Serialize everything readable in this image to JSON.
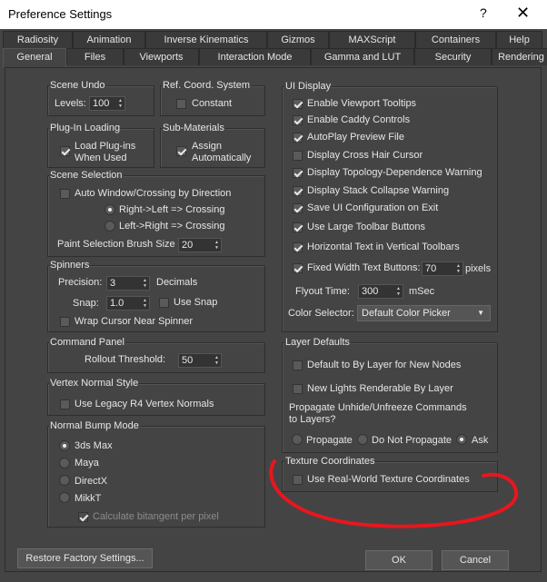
{
  "window": {
    "title": "Preference Settings",
    "help": "?",
    "close": "✕"
  },
  "tabs": {
    "row1": [
      "Radiosity",
      "Animation",
      "Inverse Kinematics",
      "Gizmos",
      "MAXScript",
      "Containers",
      "Help"
    ],
    "row2": [
      "General",
      "Files",
      "Viewports",
      "Interaction Mode",
      "Gamma and LUT",
      "Security",
      "Rendering"
    ],
    "active": "General"
  },
  "scene_undo": {
    "title": "Scene Undo",
    "levels_label": "Levels:",
    "levels_value": "100"
  },
  "ref_coord": {
    "title": "Ref. Coord. System",
    "constant": "Constant"
  },
  "plugin_loading": {
    "title": "Plug-In Loading",
    "load_line1": "Load Plug-ins",
    "load_line2": "When Used"
  },
  "sub_materials": {
    "title": "Sub-Materials",
    "assign_line1": "Assign",
    "assign_line2": "Automatically"
  },
  "scene_selection": {
    "title": "Scene Selection",
    "auto_window": "Auto Window/Crossing by Direction",
    "right_left": "Right->Left => Crossing",
    "left_right": "Left->Right => Crossing",
    "paint_brush_label": "Paint Selection Brush Size",
    "paint_brush_value": "20"
  },
  "spinners": {
    "title": "Spinners",
    "precision_label": "Precision:",
    "precision_value": "3",
    "decimals": "Decimals",
    "snap_label": "Snap:",
    "snap_value": "1.0",
    "use_snap": "Use Snap",
    "wrap_cursor": "Wrap Cursor Near Spinner"
  },
  "command_panel": {
    "title": "Command Panel",
    "rollout_label": "Rollout Threshold:",
    "rollout_value": "50"
  },
  "vertex_normal": {
    "title": "Vertex Normal Style",
    "legacy": "Use Legacy R4 Vertex Normals"
  },
  "normal_bump": {
    "title": "Normal Bump Mode",
    "options": [
      "3ds Max",
      "Maya",
      "DirectX",
      "MikkT"
    ],
    "calc_bitangent": "Calculate bitangent per pixel"
  },
  "ui_display": {
    "title": "UI Display",
    "items": [
      "Enable Viewport Tooltips",
      "Enable Caddy Controls",
      "AutoPlay Preview File",
      "Display Cross Hair Cursor",
      "Display Topology-Dependence Warning",
      "Display Stack Collapse Warning",
      "Save UI Configuration on Exit",
      "Use Large Toolbar Buttons",
      "Horizontal Text in Vertical Toolbars"
    ],
    "fixed_width": "Fixed Width Text Buttons:",
    "fixed_width_value": "70",
    "pixels": "pixels",
    "flyout_label": "Flyout Time:",
    "flyout_value": "300",
    "msec": "mSec",
    "color_selector_label": "Color Selector:",
    "color_selector_value": "Default Color Picker"
  },
  "layer_defaults": {
    "title": "Layer Defaults",
    "default_bylayer": "Default to By Layer for New Nodes",
    "new_lights": "New Lights Renderable By Layer",
    "propagate_q1": "Propagate Unhide/Unfreeze Commands",
    "propagate_q2": "to Layers?",
    "propagate": "Propagate",
    "do_not": "Do Not Propagate",
    "ask": "Ask"
  },
  "texture_coords": {
    "title": "Texture Coordinates",
    "real_world": "Use Real-World Texture Coordinates"
  },
  "footer": {
    "restore": "Restore Factory Settings...",
    "ok": "OK",
    "cancel": "Cancel"
  },
  "colors": {
    "background": "#444444",
    "annotation": "#e8161e"
  }
}
